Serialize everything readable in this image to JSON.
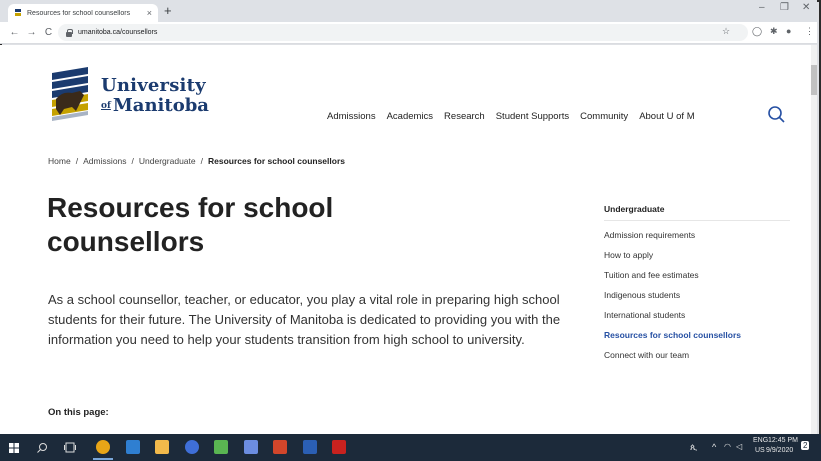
{
  "browser": {
    "tab_title": "Resources for school counsellors",
    "new_tab": "+",
    "close_tab": "×",
    "url": "umanitoba.ca/counsellors",
    "minimize": "–",
    "restore": "❐",
    "close": "✕"
  },
  "header": {
    "logo_line1": "University",
    "logo_of": "of",
    "logo_line2": "Manitoba",
    "nav": [
      "Admissions",
      "Academics",
      "Research",
      "Student Supports",
      "Community",
      "About U of M"
    ]
  },
  "breadcrumb": [
    "Home",
    "Admissions",
    "Undergraduate",
    "Resources for school counsellors"
  ],
  "main": {
    "title": "Resources for school counsellors",
    "intro": "As a school counsellor, teacher, or educator, you play a vital role in preparing high school students for their future. The University of Manitoba is dedicated to providing you with the information you need to help your students transition from high school to university.",
    "on_this_page": "On this page:"
  },
  "sidenav": {
    "heading": "Undergraduate",
    "items": [
      "Admission requirements",
      "How to apply",
      "Tuition and fee estimates",
      "Indigenous students",
      "International students",
      "Resources for school counsellors",
      "Connect with our team"
    ],
    "active_index": 5
  },
  "taskbar": {
    "lang": "ENG",
    "region": "US",
    "time": "12:45 PM",
    "date": "9/9/2020",
    "notifications": "2"
  },
  "colors": {
    "brand_blue": "#1b3b6f",
    "brand_gold": "#c5a100",
    "link_active": "#2650a3"
  }
}
